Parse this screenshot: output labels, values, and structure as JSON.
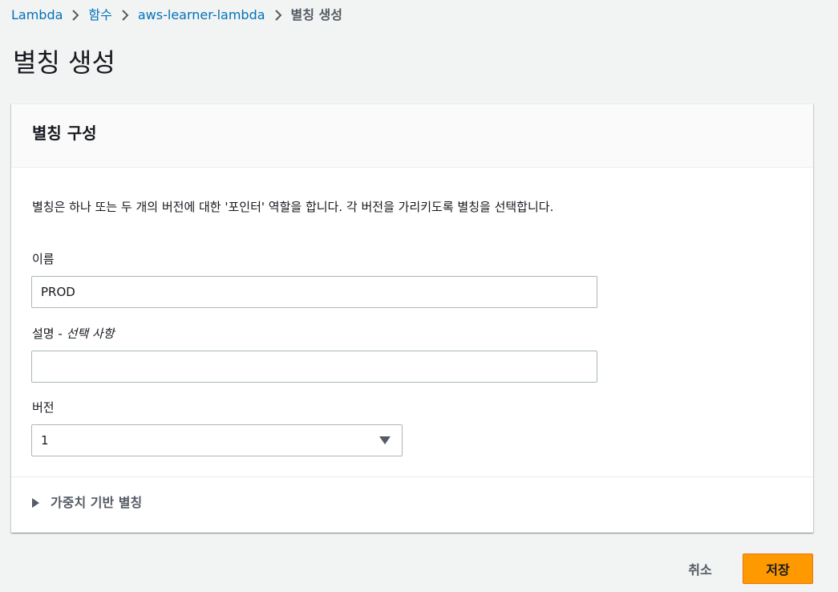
{
  "breadcrumb": {
    "items": [
      "Lambda",
      "함수",
      "aws-learner-lambda"
    ],
    "current": "별칭 생성"
  },
  "page": {
    "title": "별칭 생성"
  },
  "panel": {
    "title": "별칭 구성",
    "description": "별칭은 하나 또는 두 개의 버전에 대한 '포인터' 역할을 합니다. 각 버전을 가리키도록 별칭을 선택합니다.",
    "name_label": "이름",
    "name_value": "PROD",
    "desc_label": "설명 - ",
    "desc_optional": "선택 사항",
    "desc_value": "",
    "version_label": "버전",
    "version_value": "1",
    "weighted_label": "가중치 기반 별칭"
  },
  "actions": {
    "cancel_label": "취소",
    "save_label": "저장"
  },
  "colors": {
    "link": "#0073bb",
    "primary_button": "#ff9900",
    "background": "#f2f3f3"
  }
}
